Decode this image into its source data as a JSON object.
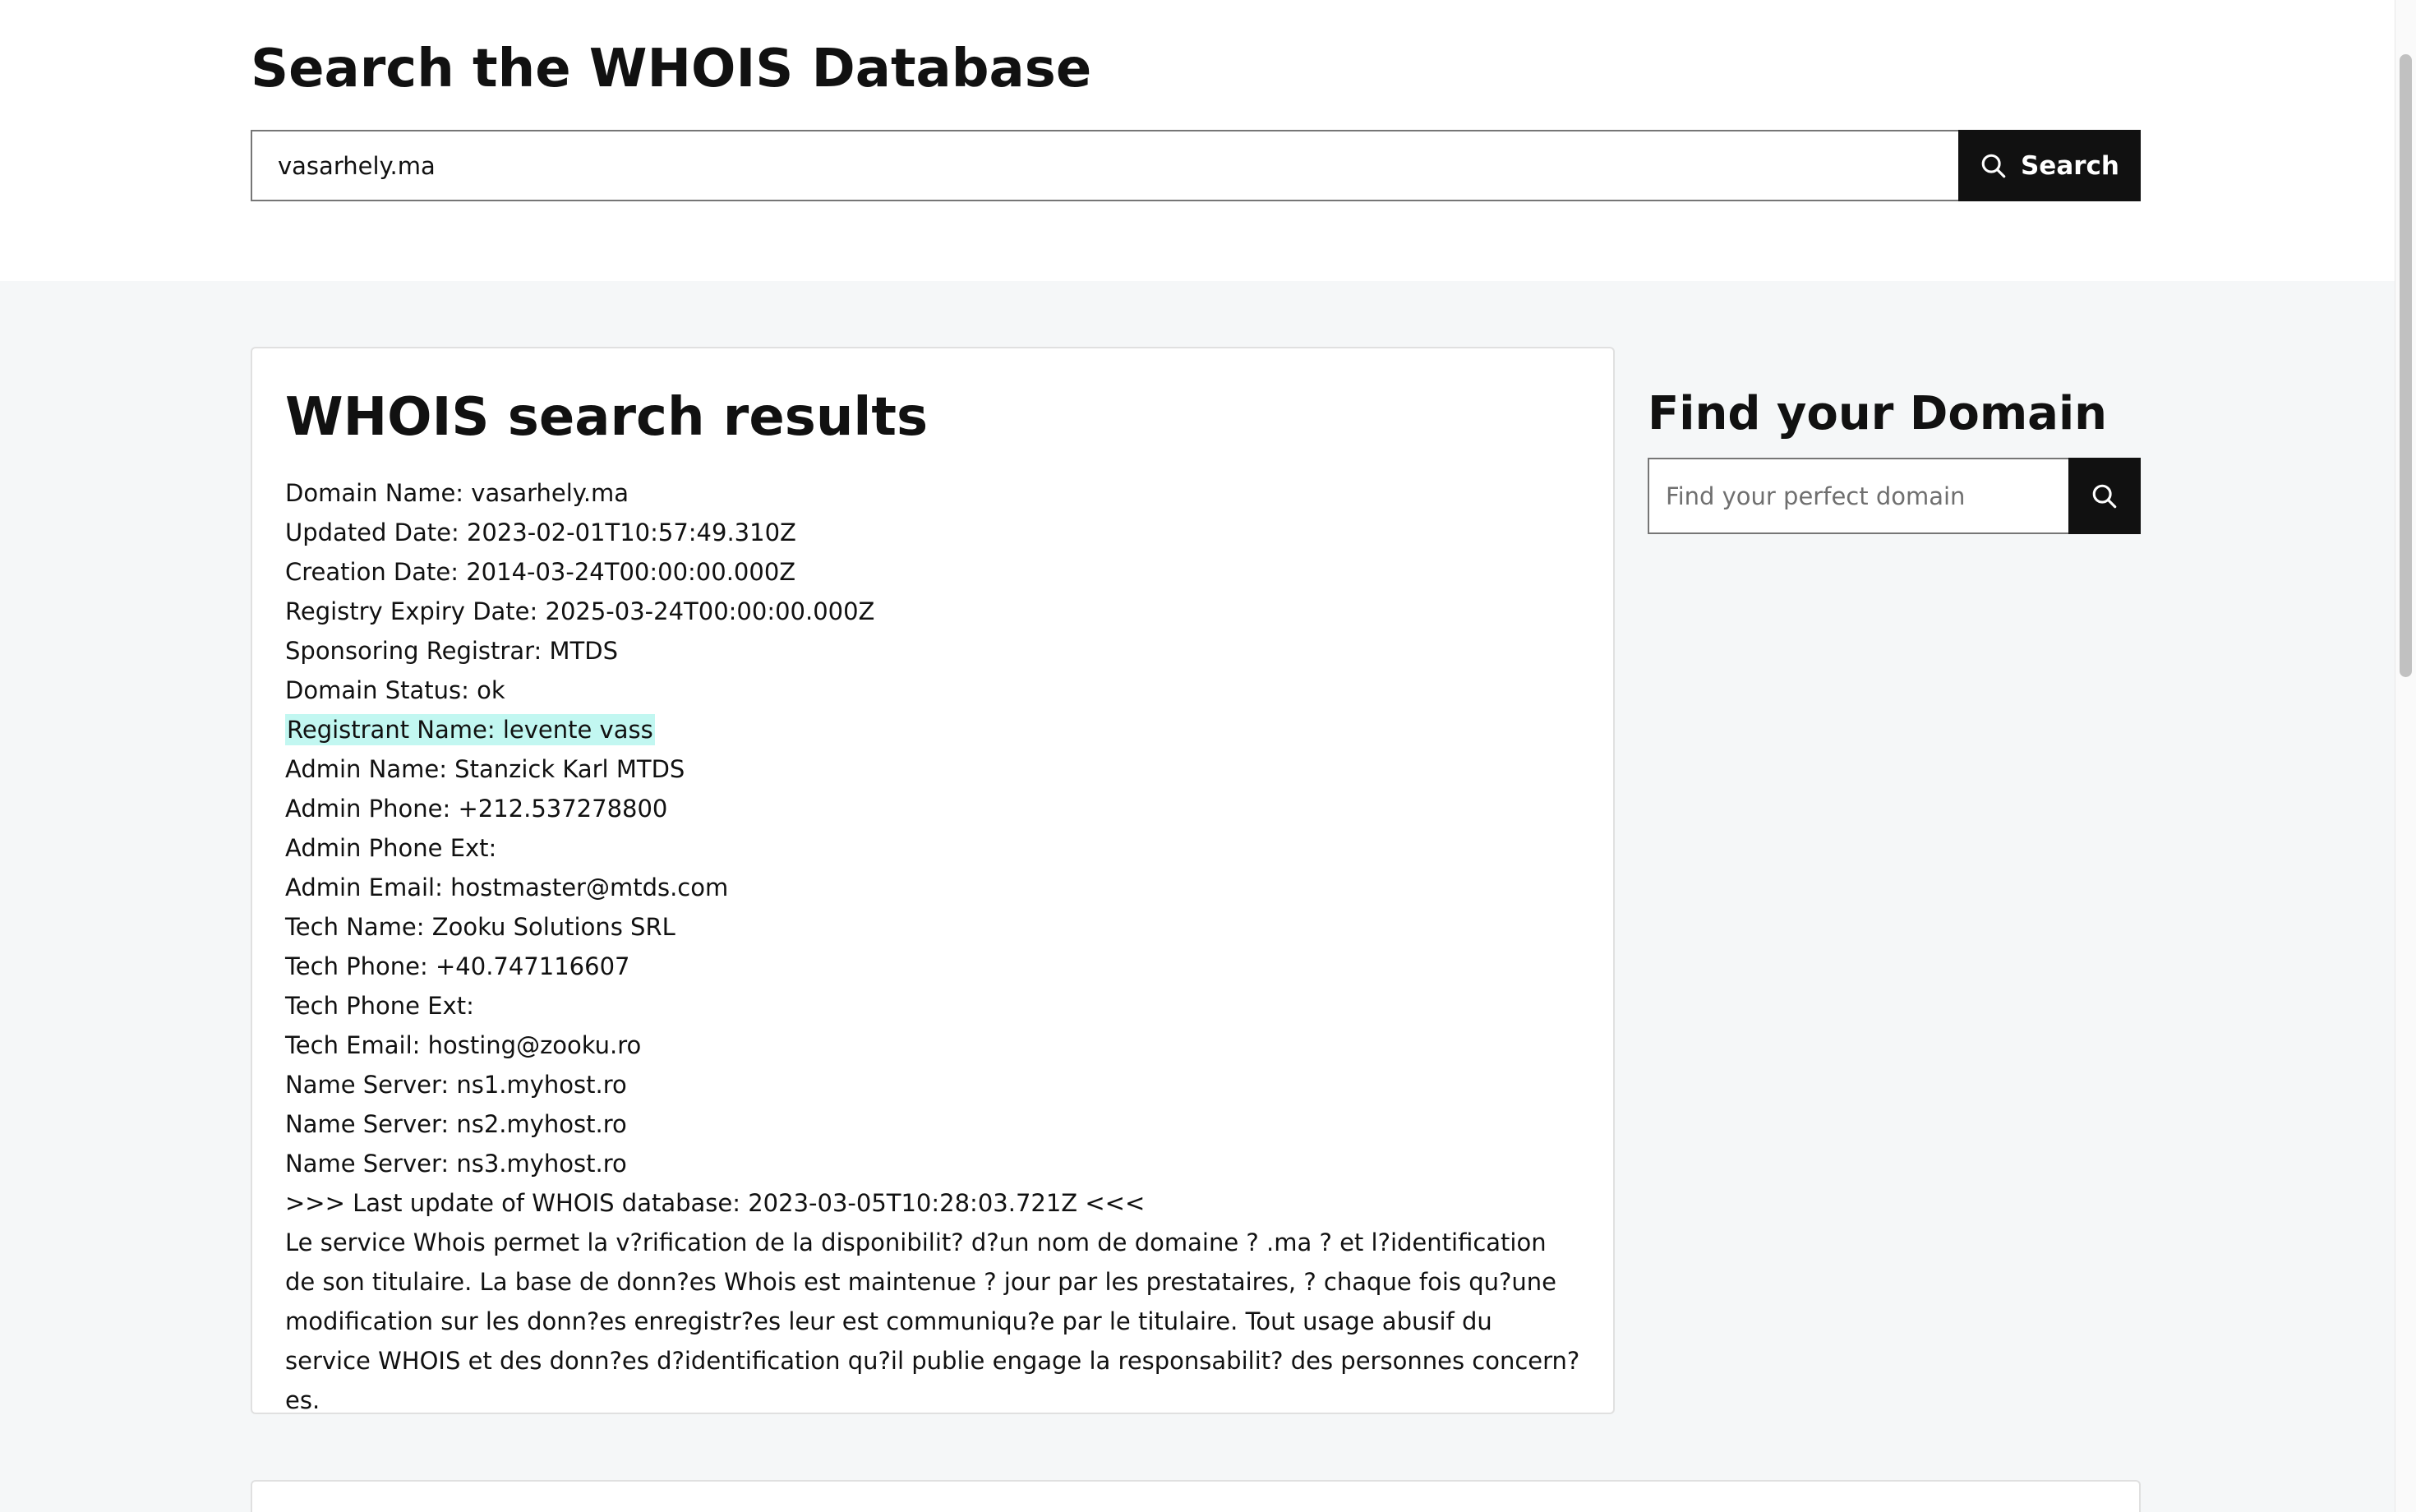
{
  "header": {
    "title": "Search the WHOIS Database",
    "search_value": "vasarhely.ma",
    "search_button_label": "Search"
  },
  "results": {
    "title": "WHOIS search results",
    "lines": [
      "Domain Name: vasarhely.ma",
      "Updated Date: 2023-02-01T10:57:49.310Z",
      "Creation Date: 2014-03-24T00:00:00.000Z",
      "Registry Expiry Date: 2025-03-24T00:00:00.000Z",
      "Sponsoring Registrar: MTDS",
      "Domain Status: ok",
      "Registrant Name: levente vass",
      "Admin Name: Stanzick Karl MTDS",
      "Admin Phone: +212.537278800",
      "Admin Phone Ext:",
      "Admin Email: hostmaster@mtds.com",
      "Tech Name: Zooku Solutions SRL",
      "Tech Phone: +40.747116607",
      "Tech Phone Ext:",
      "Tech Email: hosting@zooku.ro",
      "Name Server: ns1.myhost.ro",
      "Name Server: ns2.myhost.ro",
      "Name Server: ns3.myhost.ro",
      ">>> Last update of WHOIS database: 2023-03-05T10:28:03.721Z <<<"
    ],
    "notice": "Le service Whois permet la v?rification de la disponibilit? d?un nom de domaine ? .ma ? et l?identification de son titulaire. La base de donn?es Whois est maintenue ? jour par les prestataires, ? chaque fois qu?une modification sur les donn?es enregistr?es leur est communiqu?e par le titulaire. Tout usage abusif du service WHOIS et des donn?es d?identification qu?il publie engage la responsabilit? des personnes concern?es."
  },
  "sidebar": {
    "title": "Find your Domain",
    "input_placeholder": "Find your perfect domain"
  },
  "icons": {
    "search": "search-icon",
    "find": "search-icon"
  },
  "colors": {
    "highlight": "#c2f7f1",
    "button": "#111111",
    "main_background": "#f5f7f8"
  }
}
